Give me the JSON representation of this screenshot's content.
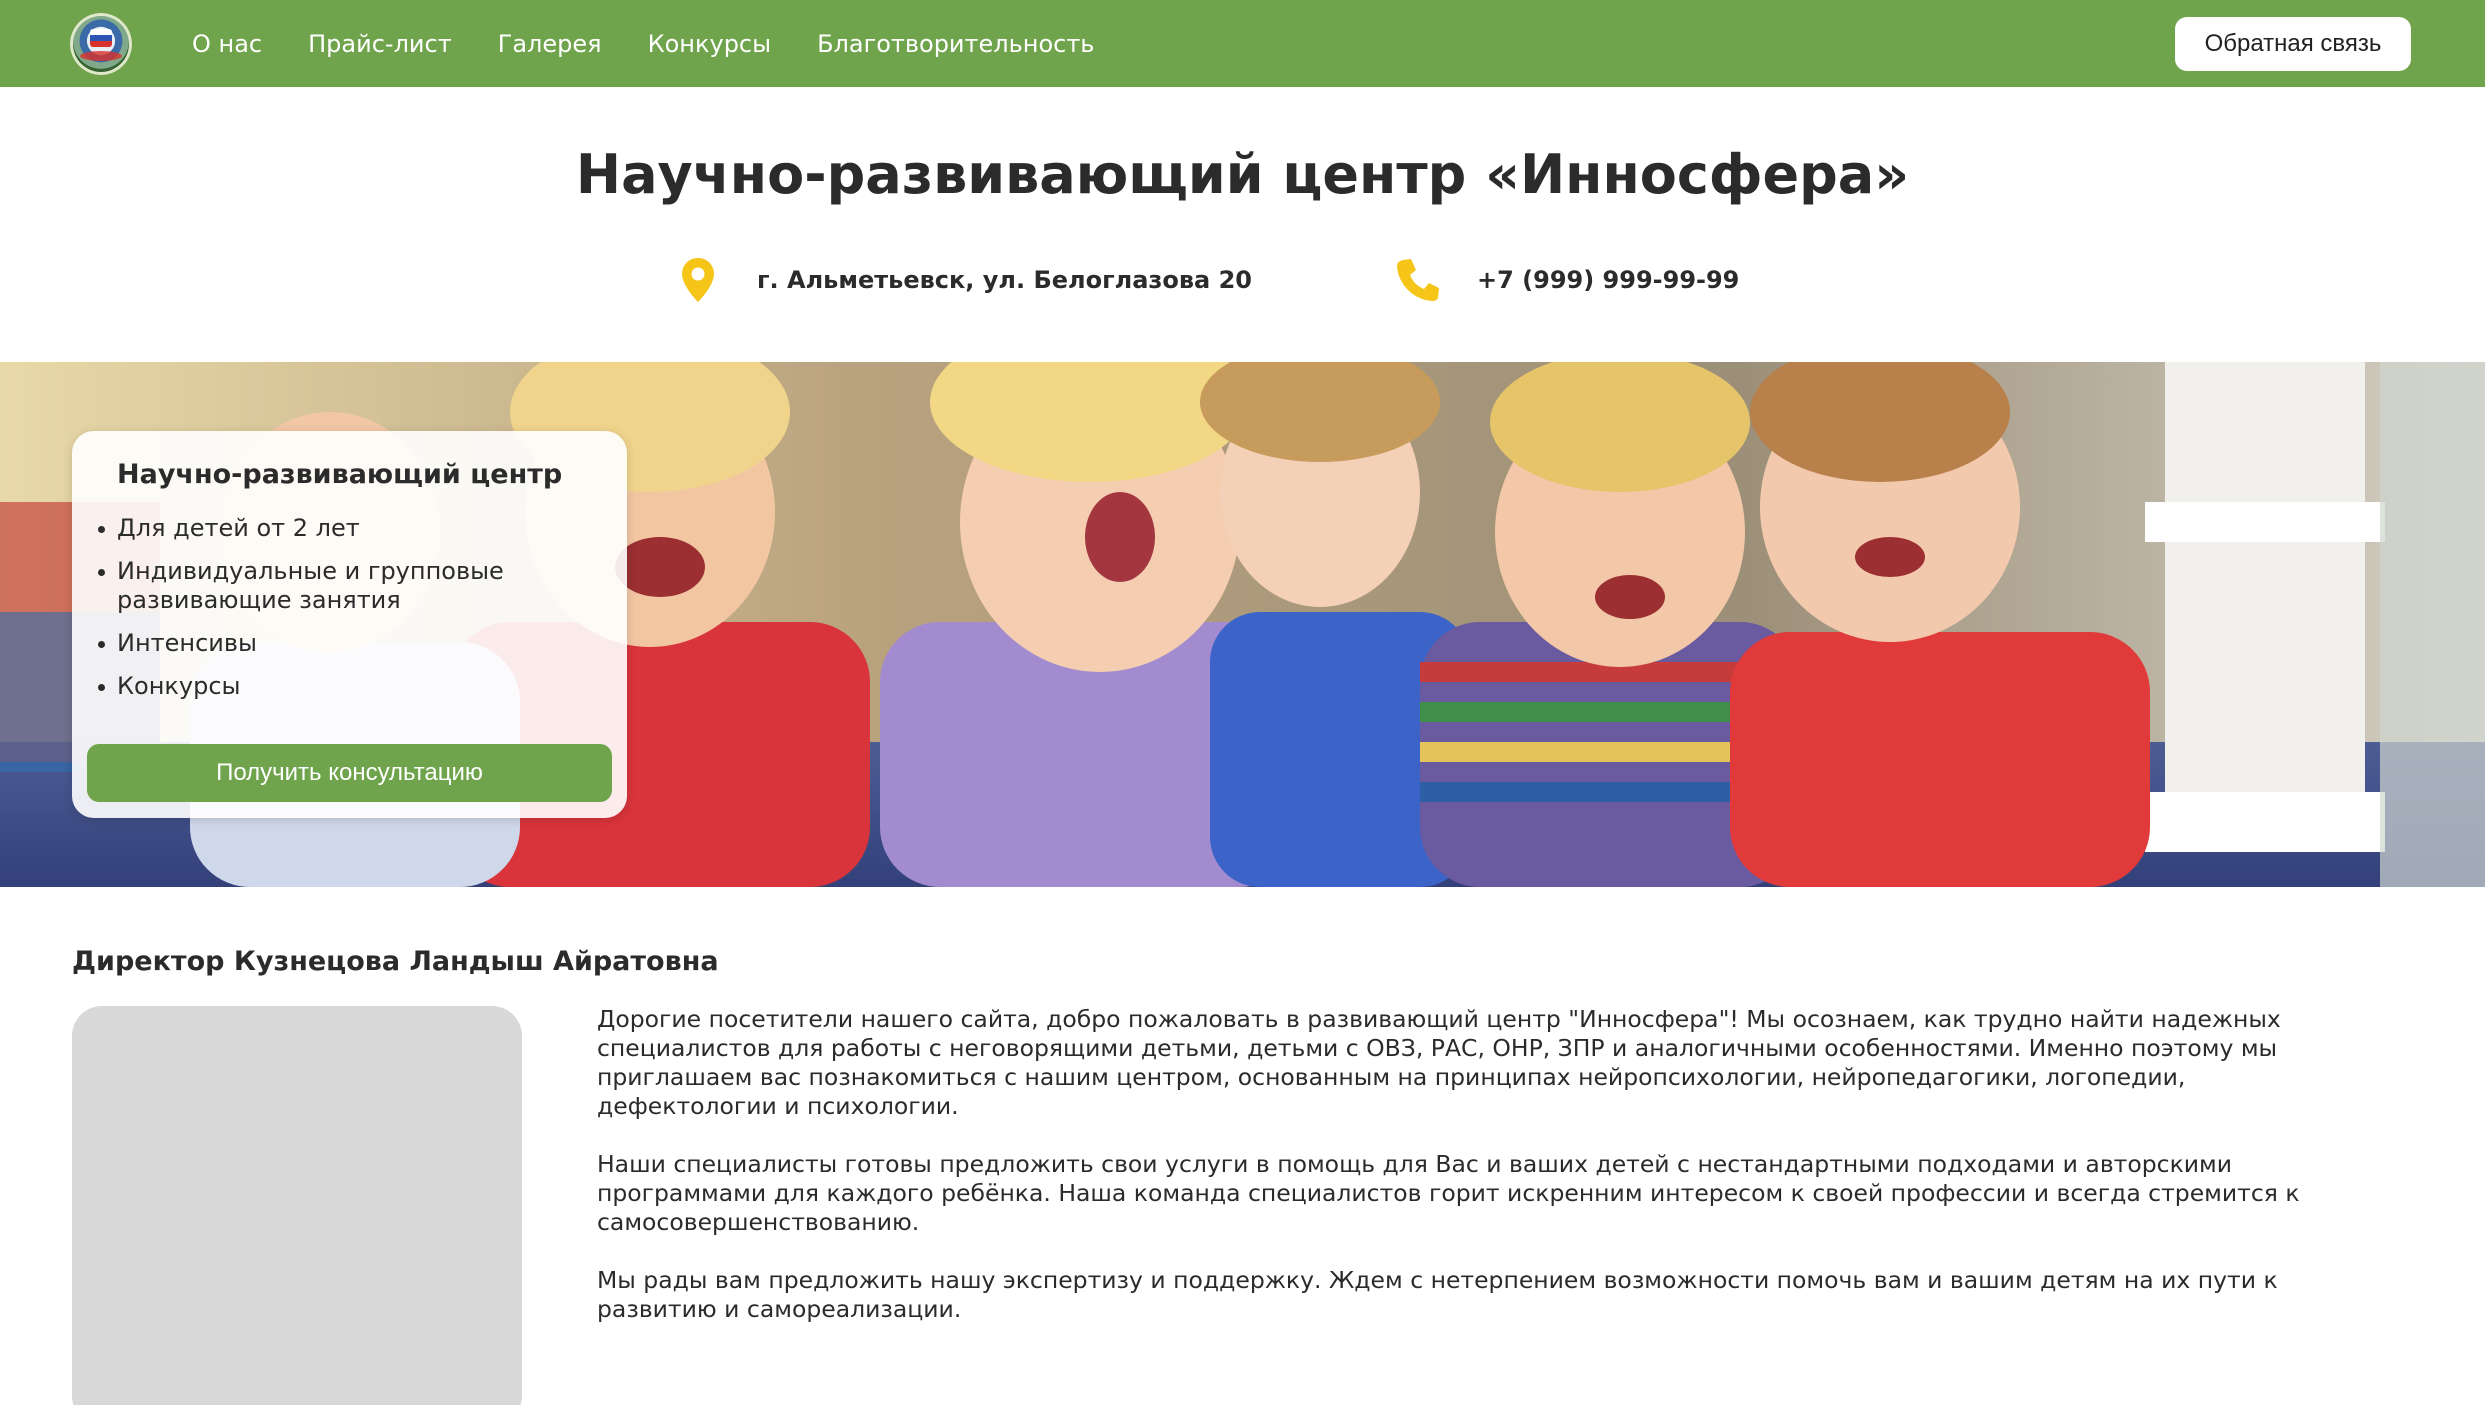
{
  "nav": {
    "links": [
      "О нас",
      "Прайс-лист",
      "Галерея",
      "Конкурсы",
      "Благотворительность"
    ],
    "feedback_label": "Обратная связь",
    "logo_icon": "center-logo-icon",
    "accent_color": "#6fa44c"
  },
  "header": {
    "title": "Научно-развивающий центр «Инносфера»",
    "address": "г. Альметьевск, ул. Белоглазова 20",
    "address_icon": "map-pin-icon",
    "phone": "+7 (999) 999-99-99",
    "phone_icon": "phone-icon",
    "icon_color": "#f5c518"
  },
  "hero": {
    "card_title": "Научно-развивающий центр",
    "items": [
      "Для детей от 2 лет",
      "Индивидуальные и групповые развивающие занятия",
      "Интенсивы",
      "Конкурсы"
    ],
    "button_label": "Получить консультацию"
  },
  "director": {
    "title": "Директор Кузнецова Ландыш Айратовна",
    "paragraphs": [
      "Дорогие посетители нашего сайта, добро пожаловать в развивающий центр \"Инносфера\"! Мы осознаем, как трудно найти надежных специалистов для работы с неговорящими детьми, детьми с ОВЗ, РАС, ОНР, ЗПР и аналогичными особенностями. Именно поэтому мы приглашаем вас познакомиться с нашим центром, основанным на принципах нейропсихологии, нейропедагогики, логопедии, дефектологии и психологии.",
      "Наши специалисты готовы предложить свои услуги в помощь для Вас и ваших детей с нестандартными подходами и авторскими программами для каждого ребёнка. Наша команда специалистов горит искренним интересом к своей профессии и всегда стремится к самосовершенствованию.",
      "Мы рады вам предложить нашу экспертизу и поддержку. Ждем с нетерпением возможности помочь вам и вашим детям на их пути к развитию и самореализации."
    ]
  }
}
